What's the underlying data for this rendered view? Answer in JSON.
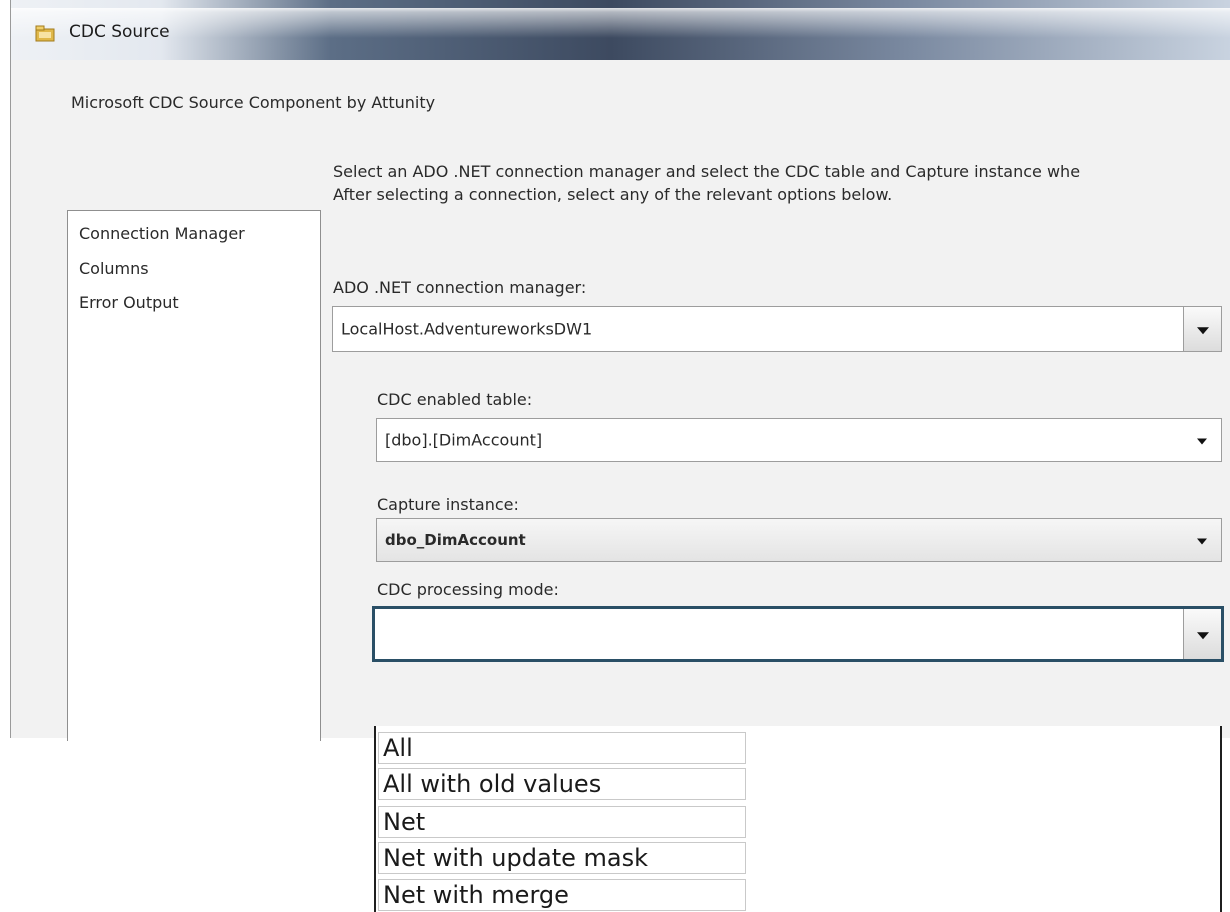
{
  "window": {
    "title": "CDC Source",
    "subtitle": "Microsoft CDC Source Component by Attunity"
  },
  "nav": {
    "items": [
      {
        "label": "Connection Manager"
      },
      {
        "label": "Columns"
      },
      {
        "label": "Error Output"
      }
    ]
  },
  "main": {
    "description_line1": "Select an ADO .NET connection manager and select the CDC table and Capture instance whe",
    "description_line2": "After selecting a connection, select any of the relevant options below.",
    "connection": {
      "label": "ADO .NET connection manager:",
      "value": "LocalHost.AdventureworksDW1"
    },
    "table": {
      "label": "CDC enabled table:",
      "value": "[dbo].[DimAccount]"
    },
    "capture": {
      "label": "Capture instance:",
      "value": "dbo_DimAccount"
    },
    "mode": {
      "label": "CDC processing mode:",
      "value": "",
      "options": [
        "All",
        "All with old values",
        "Net",
        "Net with update mask",
        "Net with merge"
      ]
    }
  }
}
